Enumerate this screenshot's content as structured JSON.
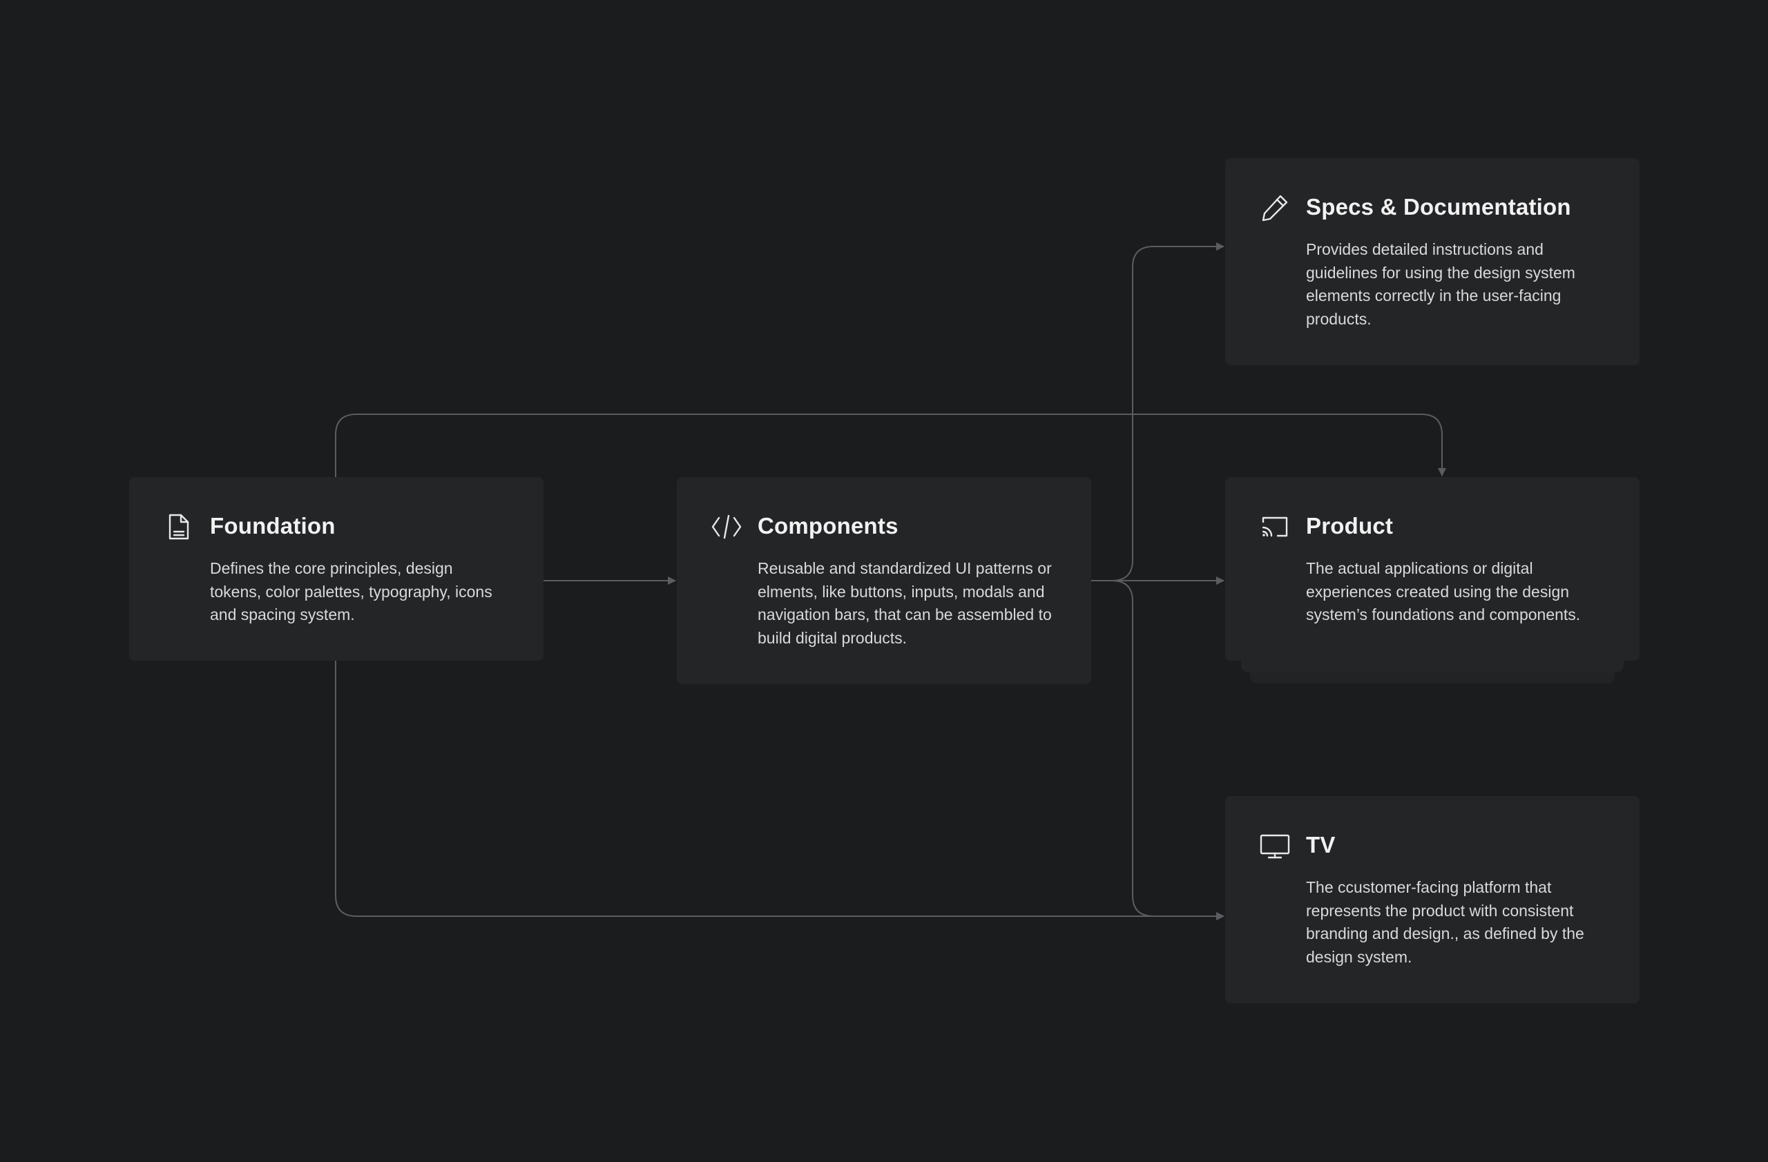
{
  "colors": {
    "background": "#1b1c1e",
    "card": "#242527",
    "connector": "#5c5d60",
    "title": "#f2f2f2",
    "text": "#d9d9d9"
  },
  "cards": {
    "foundation": {
      "icon": "document-icon",
      "title": "Foundation",
      "description": "Defines the core principles, design tokens, color palettes, typography, icons and spacing system."
    },
    "components": {
      "icon": "code-icon",
      "title": "Components",
      "description": "Reusable and standardized UI patterns or elments, like buttons, inputs, modals and navigation bars, that can be assembled to build digital products."
    },
    "specs": {
      "icon": "pencil-icon",
      "title": "Specs & Documentation",
      "description": "Provides detailed instructions and guidelines for using the design system elements correctly in the user-facing products."
    },
    "product": {
      "icon": "cast-icon",
      "title": "Product",
      "description": "The actual applications or digital experiences created using the design system’s foundations and components."
    },
    "tv": {
      "icon": "monitor-icon",
      "title": "TV",
      "description": "The ccustomer-facing platform that represents the product with consistent branding and design., as defined by the design system."
    }
  },
  "connections": [
    {
      "from": "foundation",
      "to": "components"
    },
    {
      "from": "foundation",
      "to": "product"
    },
    {
      "from": "foundation",
      "to": "tv"
    },
    {
      "from": "components",
      "to": "specs"
    },
    {
      "from": "components",
      "to": "product"
    },
    {
      "from": "components",
      "to": "tv"
    }
  ]
}
